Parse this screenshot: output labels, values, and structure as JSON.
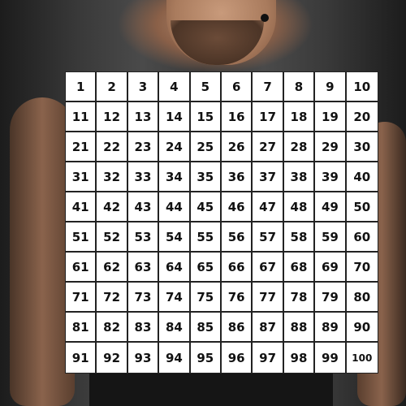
{
  "image": {
    "background": "photo of shirtless tattooed man behind a chart",
    "colors": {
      "grid_bg": "#ffffff",
      "grid_lines": "#222222",
      "text": "#111111"
    }
  },
  "hundred_chart": {
    "rows": 10,
    "cols": 10,
    "numbers": [
      "1",
      "2",
      "3",
      "4",
      "5",
      "6",
      "7",
      "8",
      "9",
      "10",
      "11",
      "12",
      "13",
      "14",
      "15",
      "16",
      "17",
      "18",
      "19",
      "20",
      "21",
      "22",
      "23",
      "24",
      "25",
      "26",
      "27",
      "28",
      "29",
      "30",
      "31",
      "32",
      "33",
      "34",
      "35",
      "36",
      "37",
      "38",
      "39",
      "40",
      "41",
      "42",
      "43",
      "44",
      "45",
      "46",
      "47",
      "48",
      "49",
      "50",
      "51",
      "52",
      "53",
      "54",
      "55",
      "56",
      "57",
      "58",
      "59",
      "60",
      "61",
      "62",
      "63",
      "64",
      "65",
      "66",
      "67",
      "68",
      "69",
      "70",
      "71",
      "72",
      "73",
      "74",
      "75",
      "76",
      "77",
      "78",
      "79",
      "80",
      "81",
      "82",
      "83",
      "84",
      "85",
      "86",
      "87",
      "88",
      "89",
      "90",
      "91",
      "92",
      "93",
      "94",
      "95",
      "96",
      "97",
      "98",
      "99",
      "100"
    ]
  }
}
